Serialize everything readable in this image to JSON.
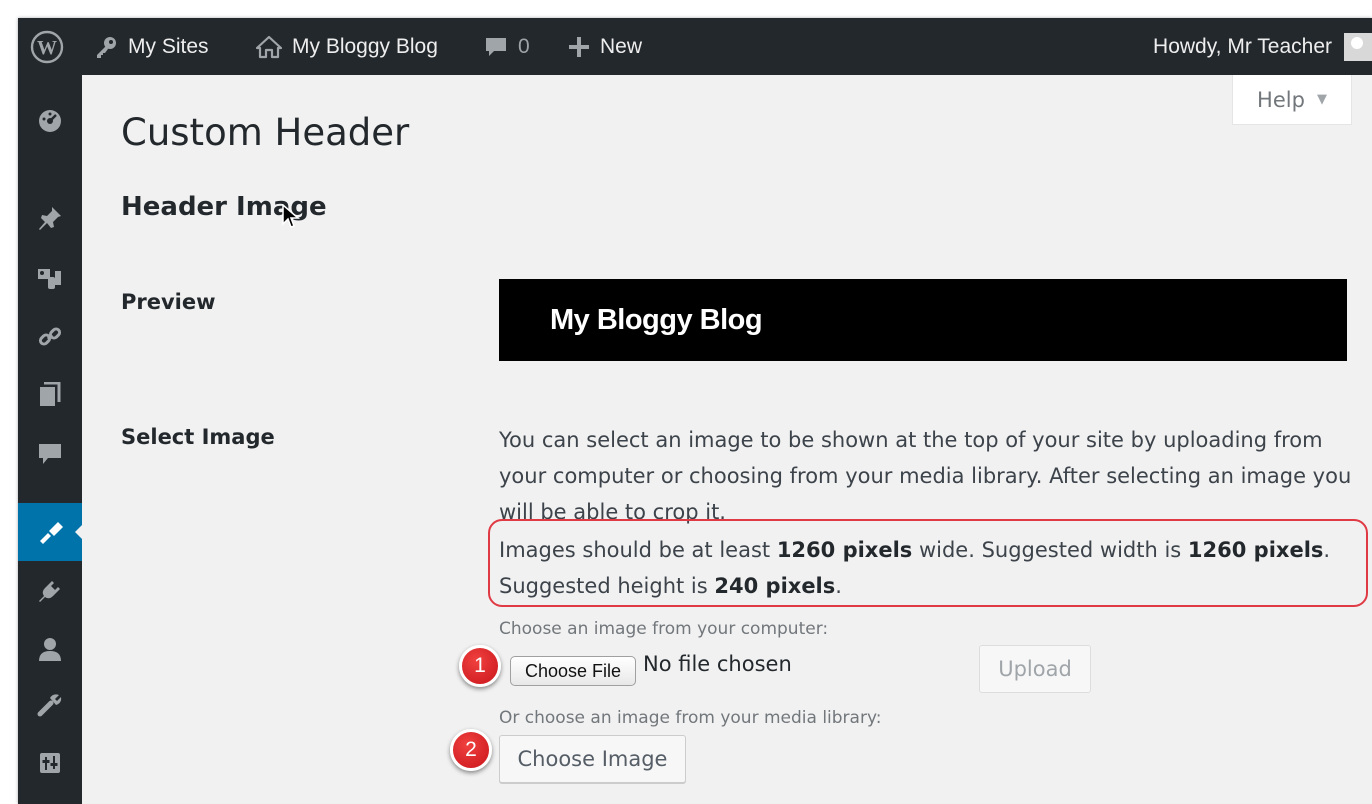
{
  "admin_bar": {
    "wp_logo_icon": "wordpress-logo-icon",
    "my_sites": "My Sites",
    "site_name": "My Bloggy Blog",
    "comments_count": "0",
    "new_label": "New",
    "howdy": "Howdy, Mr Teacher"
  },
  "sidebar": {
    "icons": [
      "dashboard-icon",
      "pin-icon",
      "media-icon",
      "links-icon",
      "pages-icon",
      "comments-icon",
      "appearance-icon",
      "plugins-icon",
      "users-icon",
      "tools-icon",
      "settings-icon"
    ],
    "active_item": "appearance-icon"
  },
  "help": {
    "label": "Help",
    "caret": "▼"
  },
  "page": {
    "title": "Custom Header",
    "section_title": "Header Image",
    "preview_label": "Preview",
    "preview_site_title": "My Bloggy Blog",
    "select_image_label": "Select Image",
    "description": "You can select an image to be shown at the top of your site by uploading from your computer or choosing from your media library. After selecting an image you will be able to crop it.",
    "size_text": {
      "part1": "Images should be at least ",
      "min_width": "1260 pixels",
      "part2": " wide. Suggested width is ",
      "suggested_width": "1260 pixels",
      "part3": ". Suggested height is ",
      "suggested_height": "240 pixels",
      "part4": "."
    },
    "choose_from_computer": "Choose an image from your computer:",
    "choose_file_button": "Choose File",
    "no_file_chosen": "No file chosen",
    "upload_button": "Upload",
    "choose_from_library": "Or choose an image from your media library:",
    "choose_image_button": "Choose Image"
  },
  "annotations": {
    "step1": "1",
    "step2": "2"
  },
  "colors": {
    "admin_bar": "#23282d",
    "active_menu": "#0073aa",
    "highlight_border": "#e03a45",
    "badge": "#d3191f",
    "page_bg": "#f1f1f1"
  }
}
